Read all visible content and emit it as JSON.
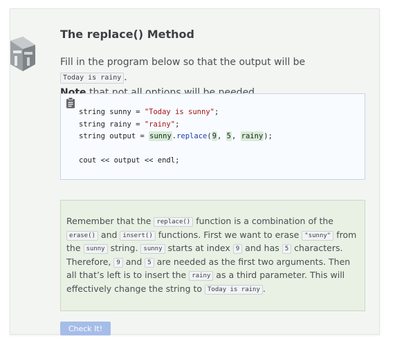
{
  "header": {
    "title": "The replace() Method"
  },
  "intro": {
    "part1": "Fill in the program below so that the output will be ",
    "output_code": "Today is rainy",
    "part2": ".",
    "note_bold": "Note",
    "note_rest": " that not all options will be needed."
  },
  "code": {
    "line1_prefix": "string sunny = ",
    "line1_str": "\"Today is sunny\"",
    "line1_end": ";",
    "line2_prefix": "string rainy = ",
    "line2_str": "\"rainy\"",
    "line2_end": ";",
    "line3_prefix": "string output = ",
    "blank1": "sunny",
    "dot": ".",
    "method": "replace",
    "open": "(",
    "blank2": "9",
    "comma1": ", ",
    "blank3": "5",
    "comma2": ", ",
    "blank4": "rainy",
    "close": ");",
    "line4": "cout << output << endl;"
  },
  "hint": {
    "t1": "Remember that the ",
    "c1": "replace()",
    "t2": " function is a combination of the ",
    "c2": "erase()",
    "t3": " and ",
    "c3": "insert()",
    "t4": " functions. First we want to erase ",
    "c4": "\"sunny\"",
    "t5": " from the ",
    "c5": "sunny",
    "t6": " string. ",
    "c6": "sunny",
    "t7": " starts at index ",
    "c7": "9",
    "t8": " and has ",
    "c8": "5",
    "t9": " characters. Therefore, ",
    "c9": "9",
    "t10": " and ",
    "c10": "5",
    "t11": " are needed as the first two arguments. Then all that’s left is to insert the ",
    "c11": "rainy",
    "t12": " as a third parameter. This will effectively change the string to ",
    "c12": "Today is rainy",
    "t13": "."
  },
  "actions": {
    "check_label": "Check It!"
  },
  "colors": {
    "card_bg": "#f3f5f3",
    "code_bg": "#f8fbff",
    "hint_bg": "#e9f1e4",
    "blank_bg": "#d6ecd6",
    "button_bg": "#a5bde8",
    "string_color": "#a31515",
    "method_color": "#1a3ea8"
  },
  "icons": {
    "logo": "codio-logo-icon",
    "clipboard": "clipboard-icon"
  }
}
